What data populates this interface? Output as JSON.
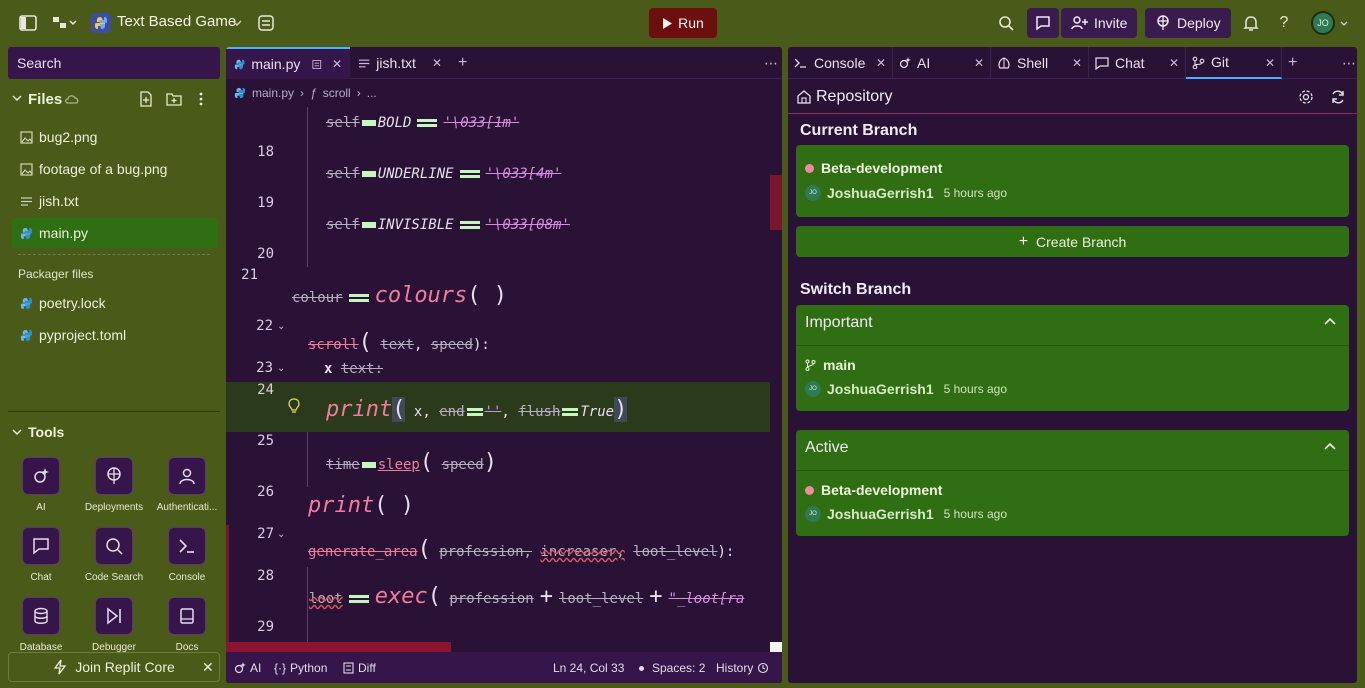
{
  "topbar": {
    "project_name": "Text Based Game",
    "run_label": "Run",
    "invite_label": "Invite",
    "deploy_label": "Deploy",
    "help_label": "?",
    "avatar_initials": "JO"
  },
  "sidebar": {
    "search_placeholder": "Search",
    "files_title": "Files",
    "files": [
      {
        "name": "bug2.png",
        "icon": "image-icon"
      },
      {
        "name": "footage of a bug.png",
        "icon": "image-icon"
      },
      {
        "name": "jish.txt",
        "icon": "text-file-icon"
      },
      {
        "name": "main.py",
        "icon": "python-icon"
      }
    ],
    "packager_title": "Packager files",
    "packager_files": [
      {
        "name": "poetry.lock",
        "icon": "python-icon"
      },
      {
        "name": "pyproject.toml",
        "icon": "python-icon"
      }
    ],
    "tools_title": "Tools",
    "tools": [
      "AI",
      "Deployments",
      "Authenticati...",
      "Chat",
      "Code Search",
      "Console",
      "Database",
      "Debugger",
      "Docs"
    ],
    "join_label": "Join Replit Core"
  },
  "editor": {
    "tabs": [
      "main.py",
      "jish.txt"
    ],
    "breadcrumb": {
      "file": "main.py",
      "symbol": "scroll",
      "more": "..."
    },
    "lines": {
      "l17": {
        "self": "self",
        "attr": "BOLD",
        "val": "'\\033[1m'"
      },
      "n18": "18",
      "l18": {
        "self": "self",
        "attr": "UNDERLINE",
        "val": "'\\033[4m'"
      },
      "n19": "19",
      "l19": {
        "self": "self",
        "attr": "INVISIBLE",
        "val": "'\\033[08m'"
      },
      "n20": "20",
      "n21": "21",
      "l21": {
        "var": "colour",
        "fn": "colours",
        "parens": "( )"
      },
      "n22": "22",
      "l22": {
        "fn": "scroll",
        "a1": "text",
        "a2": "speed",
        "end": "):"
      },
      "n23": "23",
      "l23": {
        "x": "x",
        "in": "text:"
      },
      "n24": "24",
      "l24": {
        "fn": "print",
        "x": "x,",
        "end": "end",
        "endval": "''",
        "flush": "flush",
        "flushval": "True"
      },
      "n25": "25",
      "l25": {
        "obj": "time",
        "fn": "sleep",
        "arg": "speed"
      },
      "n26": "26",
      "l26": {
        "fn": "print",
        "parens": "( )"
      },
      "n27": "27",
      "l27": {
        "fn": "generate_area",
        "a1": "profession,",
        "a2": "increaser,",
        "a3": "loot_level",
        "end": "):"
      },
      "n28": "28",
      "l28": {
        "var": "loot",
        "fn": "exec",
        "a1": "profession",
        "a2": "loot_level",
        "str": "\"_loot[ra"
      },
      "n29": "29"
    },
    "status": {
      "ai": "AI",
      "lang": "Python",
      "diff": "Diff",
      "position": "Ln 24, Col 33",
      "spaces": "Spaces: 2",
      "history": "History"
    }
  },
  "git_panel": {
    "tabs": [
      "Console",
      "AI",
      "Shell",
      "Chat",
      "Git"
    ],
    "title": "Repository",
    "current_branch_heading": "Current Branch",
    "current_branch": {
      "name": "Beta-development",
      "author": "JoshuaGerrish1",
      "time": "5 hours ago"
    },
    "create_branch_label": "Create Branch",
    "switch_branch_heading": "Switch Branch",
    "important_heading": "Important",
    "important_branch": {
      "name": "main",
      "author": "JoshuaGerrish1",
      "time": "5 hours ago"
    },
    "active_heading": "Active",
    "active_branch": {
      "name": "Beta-development",
      "author": "JoshuaGerrish1",
      "time": "5 hours ago"
    },
    "avatar_initials": "JO"
  },
  "colors": {
    "background": "#4a5a18",
    "panel": "#2a1236",
    "run_button": "#6e0f0f",
    "card_green": "#2f6e12",
    "tab_accent": "#4ab0ff"
  }
}
